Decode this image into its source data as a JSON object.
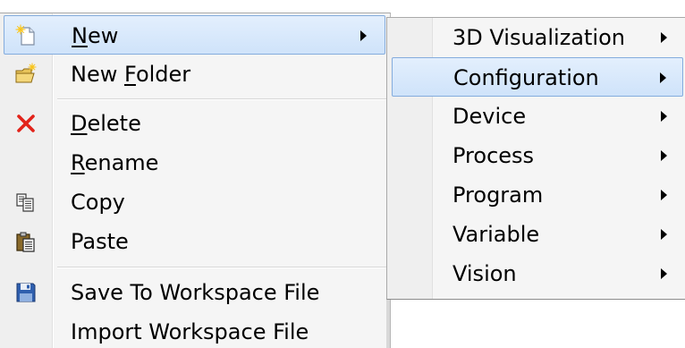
{
  "context_menu": {
    "items": [
      {
        "label_pre": "",
        "label_acc": "N",
        "label_post": "ew",
        "has_submenu": true,
        "highlighted": true,
        "icon": "new-document-icon"
      },
      {
        "label_pre": "New ",
        "label_acc": "F",
        "label_post": "older",
        "has_submenu": false,
        "icon": "new-folder-icon"
      },
      {
        "label_pre": "",
        "label_acc": "D",
        "label_post": "elete",
        "has_submenu": false,
        "icon": "delete-x-icon"
      },
      {
        "label_pre": "",
        "label_acc": "R",
        "label_post": "ename",
        "has_submenu": false,
        "icon": ""
      },
      {
        "label_pre": "",
        "label_acc": "",
        "label_post": "Copy",
        "has_submenu": false,
        "icon": "copy-icon"
      },
      {
        "label_pre": "",
        "label_acc": "",
        "label_post": "Paste",
        "has_submenu": false,
        "icon": "paste-icon"
      },
      {
        "label_pre": "",
        "label_acc": "",
        "label_post": "Save To Workspace File",
        "has_submenu": false,
        "icon": "save-disk-icon"
      },
      {
        "label_pre": "",
        "label_acc": "",
        "label_post": "Import Workspace File",
        "has_submenu": false,
        "icon": ""
      }
    ]
  },
  "submenu": {
    "items": [
      {
        "label": "3D Visualization",
        "has_submenu": true
      },
      {
        "label": "Configuration",
        "has_submenu": true,
        "highlighted": true
      },
      {
        "label": "Device",
        "has_submenu": true
      },
      {
        "label": "Process",
        "has_submenu": true
      },
      {
        "label": "Program",
        "has_submenu": true
      },
      {
        "label": "Variable",
        "has_submenu": true
      },
      {
        "label": "Vision",
        "has_submenu": true
      }
    ]
  },
  "colors": {
    "highlight_top": "#e3effd",
    "highlight_bottom": "#cfe3fa",
    "highlight_border": "#84acdd",
    "menu_bg": "#f5f5f5",
    "delete_red": "#e2231a",
    "disk_blue": "#2f5fae"
  }
}
